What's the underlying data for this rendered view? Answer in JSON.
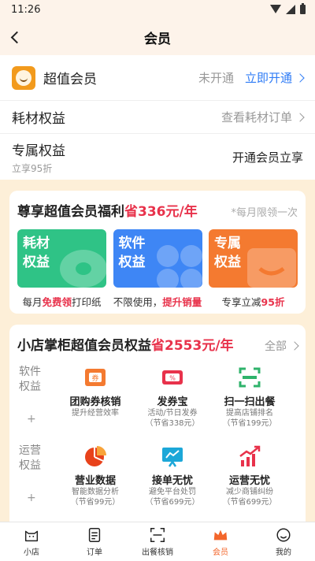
{
  "status_bar": {
    "time": "11:26"
  },
  "nav": {
    "title": "会员"
  },
  "rows": {
    "member": {
      "title": "超值会员",
      "status": "未开通",
      "action": "立即开通"
    },
    "consumables": {
      "title": "耗材权益",
      "action": "查看耗材订单"
    },
    "exclusive": {
      "title": "专属权益",
      "subtitle": "立享95折",
      "action": "开通会员立享"
    }
  },
  "welfare_card": {
    "title_prefix": "尊享超值会员福利",
    "title_highlight": "省336元/年",
    "note": "*每月限领一次",
    "tiles": [
      {
        "label": "耗材权益",
        "color": "#2fc386",
        "icon": "paper-roll-icon",
        "caption_prefix": "每月",
        "caption_highlight": "免费领",
        "caption_suffix": "打印纸"
      },
      {
        "label": "软件权益",
        "color": "#3e86f5",
        "icon": "apps-icon",
        "caption_prefix": "不限使用，",
        "caption_highlight": "提升销量",
        "caption_suffix": ""
      },
      {
        "label": "专属权益",
        "color": "#f47a30",
        "icon": "discount-tag-icon",
        "caption_prefix": "专享立减",
        "caption_highlight": "95折",
        "caption_suffix": ""
      }
    ]
  },
  "benefits_card": {
    "title_prefix": "小店掌柜超值会员权益",
    "title_highlight": "省2553元/年",
    "more": "全部",
    "groups": [
      {
        "label": "软件权益",
        "items": [
          {
            "name": "团购券核销",
            "desc1": "提升经营效率",
            "desc2": "",
            "icon": "coupon-verify-icon"
          },
          {
            "name": "发券宝",
            "desc1": "活动/节日发券",
            "desc2": "（节省338元）",
            "icon": "voucher-icon"
          },
          {
            "name": "扫一扫出餐",
            "desc1": "提高店铺排名",
            "desc2": "（节省199元）",
            "icon": "scan-icon"
          }
        ]
      },
      {
        "label": "运营权益",
        "items": [
          {
            "name": "营业数据",
            "desc1": "智能数据分析",
            "desc2": "（节省99元）",
            "icon": "pie-chart-icon"
          },
          {
            "name": "接单无忧",
            "desc1": "避免平台处罚",
            "desc2": "（节省699元）",
            "icon": "monitor-icon"
          },
          {
            "name": "运营无忧",
            "desc1": "减少商铺纠纷",
            "desc2": "（节省699元）",
            "icon": "growth-chart-icon"
          }
        ]
      }
    ]
  },
  "tab_bar": {
    "tabs": [
      {
        "label": "小店",
        "icon": "shop-cat-icon",
        "active": false
      },
      {
        "label": "订单",
        "icon": "order-list-icon",
        "active": false
      },
      {
        "label": "出餐核销",
        "icon": "scan-frame-icon",
        "active": false
      },
      {
        "label": "会员",
        "icon": "crown-icon",
        "active": true
      },
      {
        "label": "我的",
        "icon": "profile-circle-icon",
        "active": false
      }
    ]
  },
  "colors": {
    "accent_red": "#e8324b",
    "link_blue": "#2f7cf6",
    "tab_active": "#f3662b",
    "cream_bg": "#fdefd8"
  }
}
